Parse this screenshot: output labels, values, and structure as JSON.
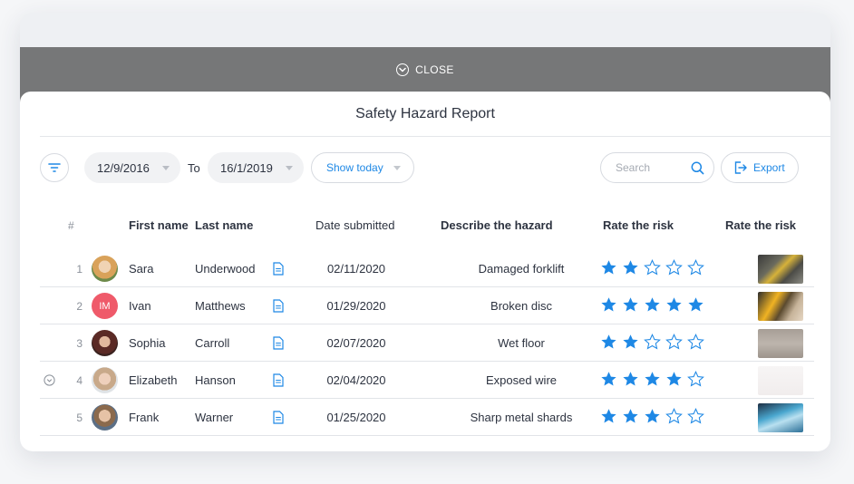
{
  "close_bar": {
    "label": "CLOSE"
  },
  "title": "Safety Hazard Report",
  "toolbar": {
    "date_from": "12/9/2016",
    "to_label": "To",
    "date_to": "16/1/2019",
    "show_today": "Show today",
    "search_placeholder": "Search",
    "export_label": "Export"
  },
  "columns": {
    "index": "#",
    "first_name": "First name",
    "last_name": "Last name",
    "date": "Date submitted",
    "hazard": "Describe the hazard",
    "risk": "Rate the risk",
    "photo": "Rate the risk"
  },
  "rows": [
    {
      "n": "1",
      "first": "Sara",
      "last": "Underwood",
      "date": "02/11/2020",
      "hazard": "Damaged forklift",
      "rating": 2,
      "avatar": "photo",
      "photo": "forklift"
    },
    {
      "n": "2",
      "first": "Ivan",
      "last": "Matthews",
      "date": "01/29/2020",
      "hazard": "Broken disc",
      "rating": 5,
      "avatar": "IM",
      "photo": "grinder"
    },
    {
      "n": "3",
      "first": "Sophia",
      "last": "Carroll",
      "date": "02/07/2020",
      "hazard": "Wet floor",
      "rating": 2,
      "avatar": "photo",
      "photo": "floor"
    },
    {
      "n": "4",
      "first": "Elizabeth",
      "last": "Hanson",
      "date": "02/04/2020",
      "hazard": "Exposed wire",
      "rating": 4,
      "avatar": "photo",
      "photo": "wire"
    },
    {
      "n": "5",
      "first": "Frank",
      "last": "Warner",
      "date": "01/25/2020",
      "hazard": "Sharp metal shards",
      "rating": 3,
      "avatar": "photo",
      "photo": "shards"
    }
  ],
  "colors": {
    "accent": "#1e88e5",
    "close_bar": "#767778",
    "initials_avatar": "#ef5a6a"
  }
}
